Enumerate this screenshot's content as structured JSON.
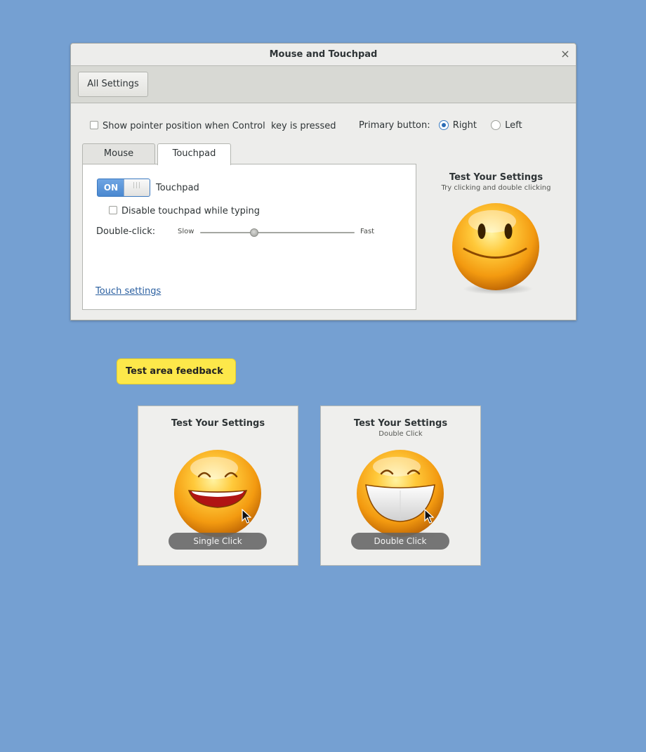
{
  "window": {
    "title": "Mouse and Touchpad",
    "close_symbol": "×",
    "all_settings_label": "All Settings"
  },
  "options": {
    "show_pointer_label": "Show pointer position when Control  key is pressed",
    "show_pointer_checked": false,
    "primary_button_label": "Primary button:",
    "primary_right_label": "Right",
    "primary_left_label": "Left",
    "primary_selected": "Right"
  },
  "tabs": [
    {
      "label": "Mouse",
      "active": false
    },
    {
      "label": "Touchpad",
      "active": true
    }
  ],
  "touchpad": {
    "switch_state": "ON",
    "touchpad_label": "Touchpad",
    "disable_while_typing_label": "Disable touchpad while typing",
    "disable_while_typing_checked": false,
    "double_click_label": "Double-click:",
    "slow_label": "Slow",
    "fast_label": "Fast",
    "double_click_speed": 0.35,
    "touch_settings_link": "Touch settings"
  },
  "test_panel": {
    "title": "Test Your Settings",
    "subtitle": "Try clicking and double clicking"
  },
  "feedback": {
    "label": "Test area feedback",
    "color": "#fde84a"
  },
  "cards": {
    "single": {
      "title": "Test Your Settings",
      "badge": "Single Click"
    },
    "double": {
      "title": "Test Your Settings",
      "subtitle": "Double Click",
      "badge": "Double Click"
    }
  },
  "colors": {
    "desktop": "#75a0d2",
    "accent": "#4a88d0",
    "link": "#2a5fa0"
  }
}
